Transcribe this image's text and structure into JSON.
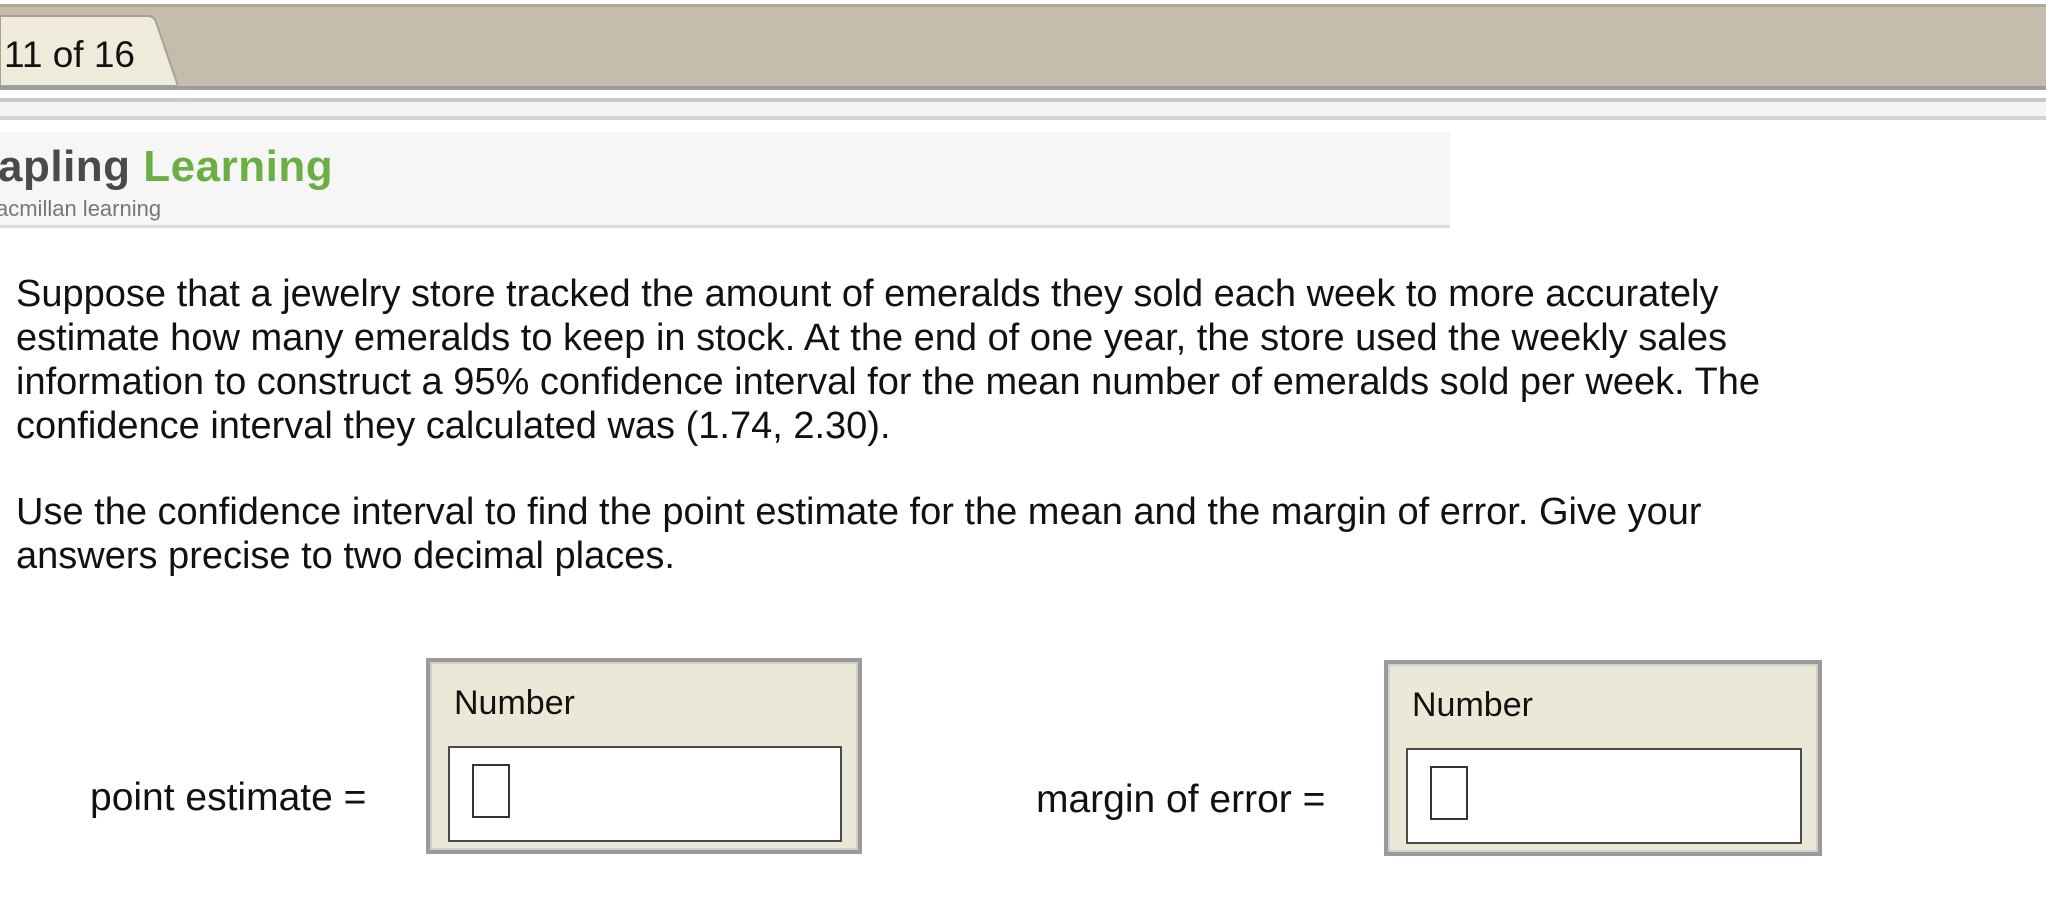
{
  "tab": {
    "label": "11 of 16"
  },
  "logo": {
    "sapling": "apling",
    "learning": "Learning",
    "subtitle": "acmillan learning"
  },
  "question": {
    "paragraph1": "Suppose that a jewelry store tracked the amount of emeralds they sold each week to more accurately\nestimate how many emeralds to keep in stock. At the end of one year, the store used the weekly sales\ninformation to construct a 95% confidence interval for the mean number of emeralds sold per week. The\nconfidence interval they calculated was (1.74, 2.30).",
    "paragraph2": "Use the confidence interval to find the point estimate for the mean and the margin of error. Give your\nanswers precise to two decimal places."
  },
  "answers": [
    {
      "label": "point estimate =",
      "header": "Number",
      "value": ""
    },
    {
      "label": "margin of error =",
      "header": "Number",
      "value": ""
    }
  ]
}
